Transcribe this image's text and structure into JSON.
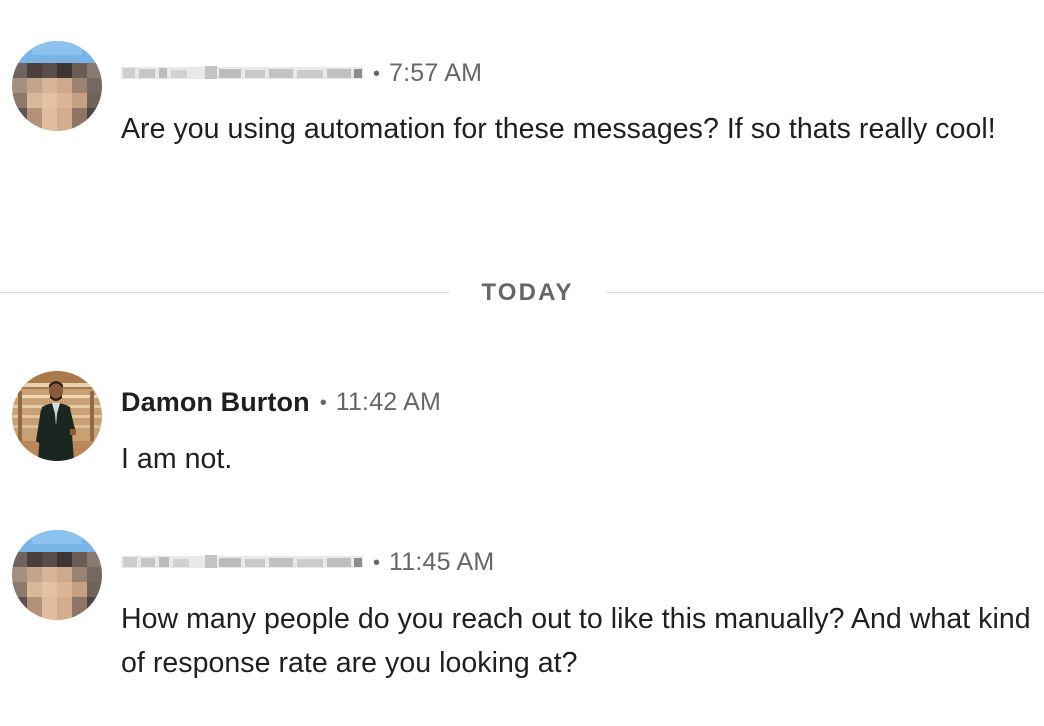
{
  "messages": [
    {
      "sender": "",
      "sender_blurred": true,
      "time": "7:57 AM",
      "text": "Are you using automation for these messages? If so thats really cool!",
      "avatar_icon": "pixelated-avatar"
    },
    {
      "sender": "Damon Burton",
      "sender_blurred": false,
      "time": "11:42 AM",
      "text": "I am not.",
      "avatar_icon": "person-in-suit-avatar"
    },
    {
      "sender": "",
      "sender_blurred": true,
      "time": "11:45 AM",
      "text": "How many people do you reach out to like this manually? And what kind of response rate are you looking at?",
      "avatar_icon": "pixelated-avatar"
    }
  ],
  "divider": {
    "label": "TODAY"
  },
  "colors": {
    "text": "#1f1f1f",
    "muted": "#666666",
    "rule": "#d9d9d9",
    "background": "#ffffff"
  }
}
